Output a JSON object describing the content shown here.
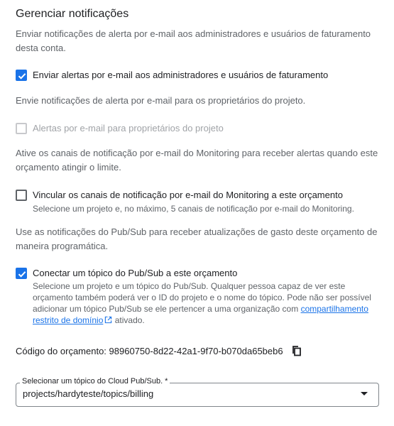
{
  "title": "Gerenciar notificações",
  "section_admin": {
    "description": "Enviar notificações de alerta por e-mail aos administradores e usuários de faturamento desta conta.",
    "checkbox_label": "Enviar alertas por e-mail aos administradores e usuários de faturamento",
    "checked": true
  },
  "section_owners": {
    "description": "Envie notificações de alerta por e-mail para os proprietários do projeto.",
    "checkbox_label": "Alertas por e-mail para proprietários do projeto",
    "checked": false,
    "disabled": true
  },
  "section_monitoring": {
    "description": "Ative os canais de notificação por e-mail do Monitoring para receber alertas quando este orçamento atingir o limite.",
    "checkbox_label": "Vincular os canais de notificação por e-mail do Monitoring a este orçamento",
    "checkbox_hint": "Selecione um projeto e, no máximo, 5 canais de notificação por e-mail do Monitoring.",
    "checked": false
  },
  "section_pubsub": {
    "description": "Use as notificações do Pub/Sub para receber atualizações de gasto deste orçamento de maneira programática.",
    "checkbox_label": "Conectar um tópico do Pub/Sub a este orçamento",
    "checkbox_hint_before_link": "Selecione um projeto e um tópico do Pub/Sub. Qualquer pessoa capaz de ver este orçamento também poderá ver o ID do projeto e o nome do tópico. Pode não ser possível adicionar um tópico Pub/Sub se ele pertencer a uma organização com ",
    "link_text": "compartilhamento restrito de domínio",
    "checkbox_hint_after_link": " ativado.",
    "checked": true
  },
  "budget_code": {
    "label": "Código do orçamento:",
    "value": "98960750-8d22-42a1-9f70-b070da65beb6"
  },
  "topic_select": {
    "label": "Selecionar um tópico do Cloud Pub/Sub. *",
    "value": "projects/hardyteste/topics/billing"
  },
  "colors": {
    "accent": "#1a73e8",
    "text": "#202124",
    "secondary_text": "#5f6368",
    "disabled": "#a0a3a7"
  },
  "icons": {
    "checkmark": "check-icon",
    "external_link": "external-link-icon",
    "copy": "copy-icon",
    "dropdown": "dropdown-arrow-icon"
  }
}
